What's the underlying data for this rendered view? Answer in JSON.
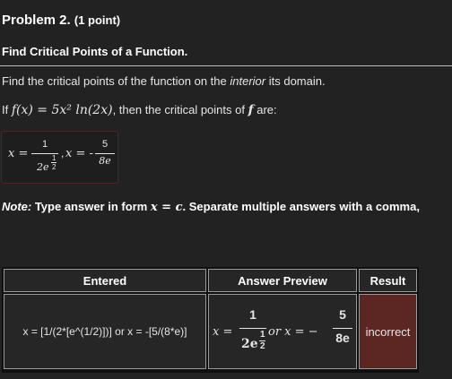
{
  "problem": {
    "title": "Problem 2.",
    "points": "(1 point)"
  },
  "section_title": "Find Critical Points of a Function.",
  "instructions": {
    "before": "Find the critical points of the function on the ",
    "emphasis": "interior",
    "after": " its domain."
  },
  "function_line": {
    "prefix": "If ",
    "expr": "f(x) = 5x² ln(2x)",
    "middle": ", then the critical points of ",
    "fname": "f",
    "suffix": " are:"
  },
  "answer_box": {
    "x_eq_1": "x =",
    "num1": "1",
    "den1_base": "2e",
    "exp_num": "1",
    "exp_den": "2",
    "sep": ",",
    "x_eq_2": "x = -",
    "num2": "5",
    "den2": "8e"
  },
  "note": {
    "label": "Note:",
    "text1": " Type answer in form ",
    "form": "x = c",
    "text2": ". Separate multiple answers with a comma,"
  },
  "results_table": {
    "headers": [
      "Entered",
      "Answer Preview",
      "Result"
    ],
    "row": {
      "entered": "x = [1/(2*[e^(1/2)])] or x = -[5/(8*e)]",
      "preview": {
        "x_eq_1": "x =",
        "num1": "1",
        "den1_base": "2e",
        "exp_num": "1",
        "exp_den": "2",
        "or_text": "or x = −",
        "num2": "5",
        "den2": "8e"
      },
      "result": "incorrect"
    }
  },
  "colors": {
    "background": "#222222",
    "text": "#e6e6e6",
    "incorrect_bg": "#5c2723",
    "box_border": "#5a1f1f"
  }
}
